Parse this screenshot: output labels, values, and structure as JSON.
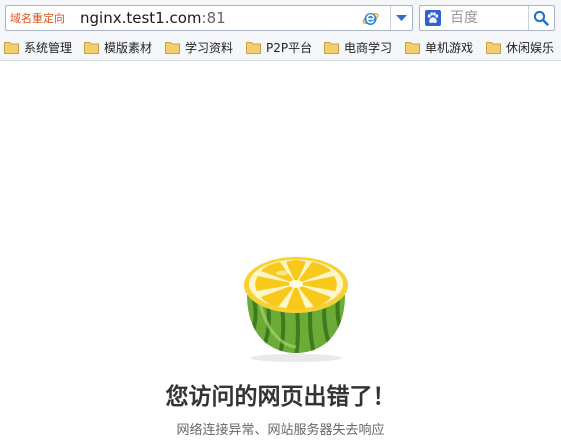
{
  "address_bar": {
    "redirect_label": "域名重定向",
    "url_host": "nginx.test1.com",
    "url_port": ":81"
  },
  "search": {
    "placeholder": "百度"
  },
  "bookmarks": [
    {
      "label": "系统管理"
    },
    {
      "label": "模版素材"
    },
    {
      "label": "学习资料"
    },
    {
      "label": "P2P平台"
    },
    {
      "label": "电商学习"
    },
    {
      "label": "单机游戏"
    },
    {
      "label": "休闲娱乐"
    }
  ],
  "error_page": {
    "title": "您访问的网页出错了！",
    "subtitle": "网络连接异常、网站服务器失去响应"
  },
  "colors": {
    "redirect_label": "#e0501b",
    "accent_blue": "#1e6fd0",
    "folder": "#f3cf6b"
  },
  "icons": {
    "browser_engine": "ie-icon",
    "search_engine": "baidu-paw-icon",
    "search_button": "magnifier-icon",
    "bookmark": "folder-icon",
    "error_illustration": "lemon-illustration"
  }
}
